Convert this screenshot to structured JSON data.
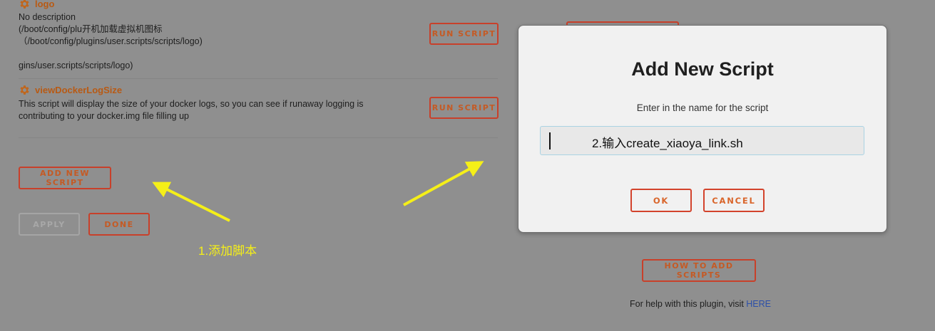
{
  "scripts": [
    {
      "name": "logo",
      "description_lines": [
        "No description",
        "(/boot/config/plu开机加载虚拟机图标",
        "（/boot/config/plugins/user.scripts/scripts/logo)",
        "",
        "gins/user.scripts/scripts/logo)"
      ],
      "run_label": "RUN SCRIPT"
    },
    {
      "name": "viewDockerLogSize",
      "description_lines": [
        "This script will display the size of your docker logs, so you can see if runaway logging is",
        "contributing to your docker.img file filling up"
      ],
      "run_label": "RUN SCRIPT"
    }
  ],
  "actions": {
    "add_new_script": "ADD NEW SCRIPT",
    "apply": "APPLY",
    "done": "DONE"
  },
  "right_column": {
    "how_to_add": "HOW TO ADD SCRIPTS",
    "help_text": "For help with this plugin, visit ",
    "help_link": "HERE"
  },
  "annotations": {
    "step1": "1.添加脚本",
    "arrow_color": "#f5ef18"
  },
  "modal": {
    "title": "Add New Script",
    "subtitle": "Enter in the name for the script",
    "input_value": "2.输入create_xiaoya_link.sh",
    "ok": "OK",
    "cancel": "CANCEL"
  },
  "colors": {
    "accent": "#c8402a",
    "overlay": "#8f8f8f",
    "modal_bg": "#f1f1f1"
  }
}
